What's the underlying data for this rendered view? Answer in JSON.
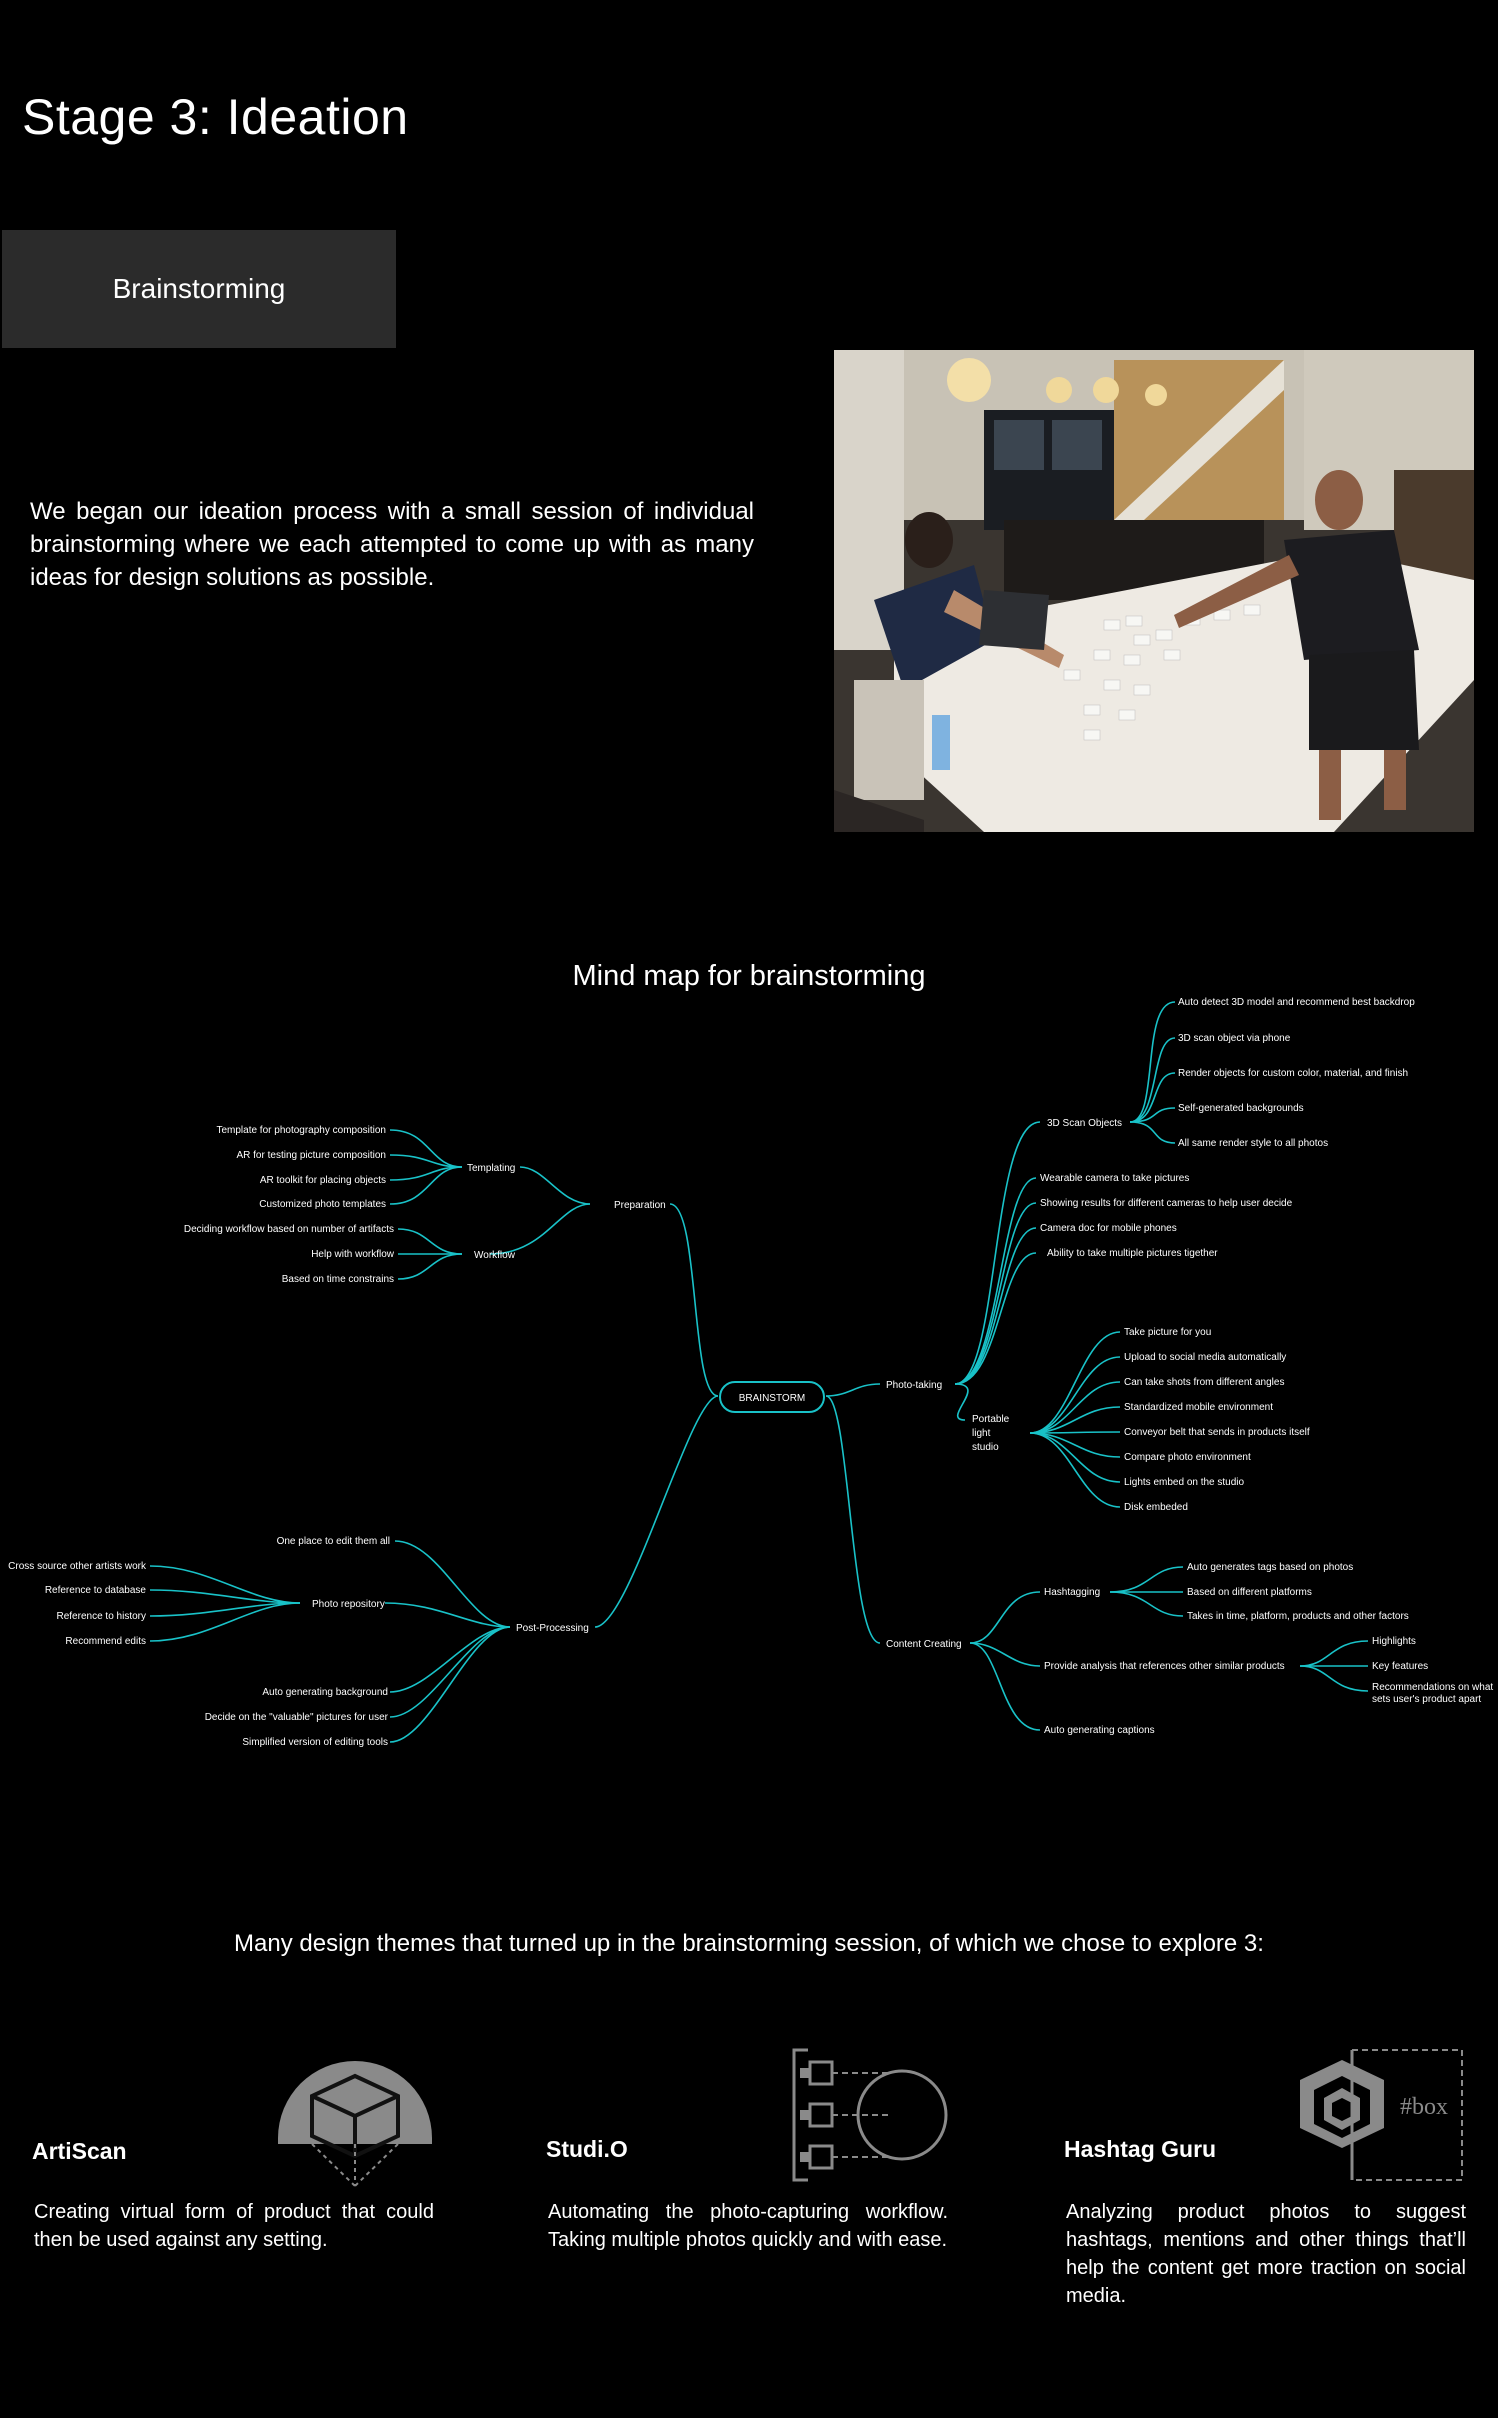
{
  "page": {
    "title": "Stage 3: Ideation",
    "tab_label": "Brainstorming",
    "intro": "We began our ideation process with a small session of individual brainstorming where we each attempted to come up with as many ideas for design solutions as possible.",
    "photo_alt": "Two team members arranging sticky notes on a counter during brainstorming"
  },
  "mindmap": {
    "title": "Mind map for brainstorming",
    "center": "BRAINSTORM",
    "preparation": {
      "label": "Preparation",
      "templating": {
        "label": "Templating",
        "items": [
          "Template for photography composition",
          "AR for testing picture composition",
          "AR toolkit for placing objects",
          "Customized photo templates"
        ]
      },
      "workflow": {
        "label": "Workflow",
        "items": [
          "Deciding workflow based on number of artifacts",
          "Help with workflow",
          "Based on time constrains"
        ]
      }
    },
    "post_processing": {
      "label": "Post-Processing",
      "edit_all": "One place to edit them all",
      "repository": {
        "label": "Photo repository",
        "items": [
          "Cross source other artists work",
          "Reference to database",
          "Reference to history",
          "Recommend edits"
        ]
      },
      "others": [
        "Auto generating background",
        "Decide on the \"valuable\" pictures for user",
        "Simplified version of editing tools"
      ]
    },
    "photo_taking": {
      "label": "Photo-taking",
      "scan": {
        "label": "3D Scan Objects",
        "items": [
          "Auto detect 3D model and recommend best backdrop",
          "3D scan object via phone",
          "Render objects for custom color, material, and finish",
          "Self-generated backgrounds",
          "All same render style to all photos"
        ]
      },
      "others": [
        "Wearable camera to take pictures",
        "Showing results for different cameras to help user decide",
        "Camera doc for mobile phones",
        "Ability to take multiple pictures tigether"
      ],
      "studio": {
        "label_lines": [
          "Portable",
          "light",
          "studio"
        ],
        "items": [
          "Take picture for you",
          "Upload to social media automatically",
          "Can take shots from different angles",
          "Standardized mobile environment",
          "Conveyor belt that sends in products itself",
          "Compare photo environment",
          "Lights embed on the studio",
          "Disk embeded"
        ]
      }
    },
    "content_creating": {
      "label": "Content Creating",
      "hashtagging": {
        "label": "Hashtagging",
        "items": [
          "Auto generates tags based on photos",
          "Based on different platforms",
          "Takes in time, platform, products and other factors"
        ]
      },
      "analysis": {
        "label": "Provide analysis that references other similar products",
        "items": [
          "Highlights",
          "Key features"
        ],
        "last_lines": [
          "Recommendations on what",
          "sets user's product apart"
        ]
      },
      "captions": "Auto generating captions"
    }
  },
  "themes": {
    "heading": "Many design themes that turned up in the brainstorming session, of which we chose to explore 3:",
    "items": [
      {
        "title": "ArtiScan",
        "desc": "Creating virtual form of product that could then be used against any setting.",
        "icon": "dome-cube-icon"
      },
      {
        "title": "Studi.O",
        "desc": "Automating the photo-capturing workflow. Taking multiple photos quickly and with ease.",
        "icon": "camera-rig-icon"
      },
      {
        "title": "Hashtag Guru",
        "desc": "Analyzing product photos to suggest hashtags, mentions and other things that’ll help the content get more traction on social media.",
        "icon": "hashtag-box-icon",
        "icon_text": "#box"
      }
    ]
  }
}
